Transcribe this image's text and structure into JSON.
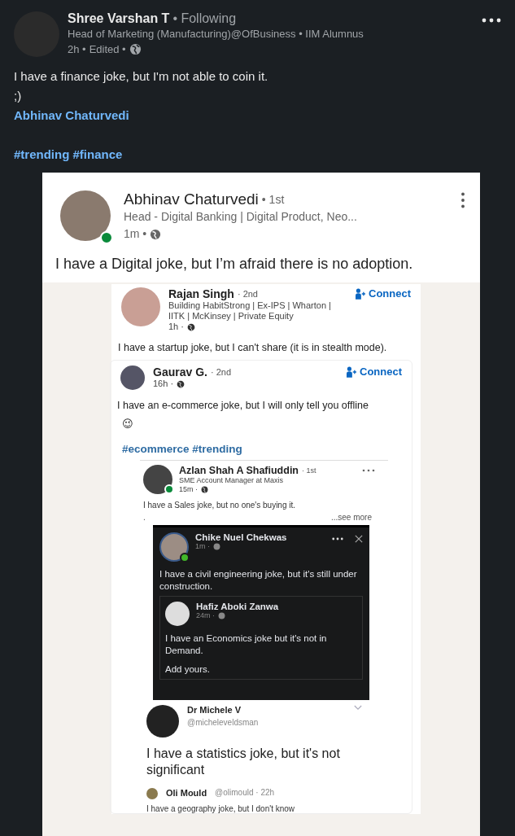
{
  "post": {
    "author": "Shree Varshan T",
    "relation": "• Following",
    "headline": "Head of Marketing (Manufacturing)@OfBusiness • IIM Alumnus",
    "time": "2h •",
    "edited": "Edited •",
    "body": [
      "I have a finance joke, but I'm not able to coin it.",
      ";)"
    ],
    "mention": "Abhinav Chaturvedi",
    "hashtags": "#trending #finance"
  },
  "shared": {
    "author": "Abhinav Chaturvedi",
    "degree": "• 1st",
    "headline": "Head - Digital Banking | Digital Product, Neo...",
    "time": "1m •",
    "online": true,
    "body": "I have a Digital joke, but I’m afraid there is no adoption."
  },
  "rajan": {
    "author": "Rajan Singh",
    "degree": "· 2nd",
    "headline": "Building HabitStrong | Ex-IPS | Wharton | IITK | McKinsey | Private Equity",
    "time": "1h ·",
    "connect": "Connect",
    "body": "I have a startup joke, but I can't share (it is in stealth mode)."
  },
  "gaurav": {
    "author": "Gaurav G.",
    "degree": "· 2nd",
    "time": "16h ·",
    "connect": "Connect",
    "body": "I have an e-commerce joke, but I will only tell you offline",
    "emoji": "😉",
    "hashtags": "#ecommerce #trending"
  },
  "azlan": {
    "author": "Azlan Shah A Shafiuddin",
    "degree": "· 1st",
    "headline": "SME Account Manager at Maxis",
    "time": "15m ·",
    "online": true,
    "body": "I have a Sales joke, but no one's buying it.",
    "dot": ".",
    "see_more": "...see more"
  },
  "chike": {
    "author": "Chike Nuel Chekwas",
    "time": "1m ·",
    "online": true,
    "body": "I have a civil engineering joke, but it's still under construction."
  },
  "hafiz": {
    "author": "Hafiz Aboki Zanwa",
    "time": "24m ·",
    "body": "I have an Economics joke but it's not in Demand.",
    "footer": "Add yours."
  },
  "michele": {
    "author": "Dr Michele V",
    "handle": "@micheleveldsman",
    "body": "I have a statistics joke, but it's not significant"
  },
  "oli": {
    "author": "Oli Mould",
    "handle": "@olimould",
    "time": "· 22h",
    "body": "I have a geography joke, but I don't know"
  }
}
